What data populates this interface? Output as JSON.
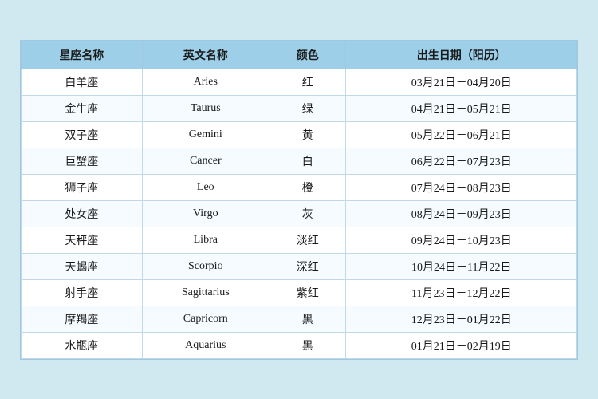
{
  "table": {
    "headers": [
      "星座名称",
      "英文名称",
      "颜色",
      "出生日期（阳历）"
    ],
    "rows": [
      {
        "chinese": "白羊座",
        "english": "Aries",
        "color": "红",
        "dates": "03月21日－04月20日"
      },
      {
        "chinese": "金牛座",
        "english": "Taurus",
        "color": "绿",
        "dates": "04月21日－05月21日"
      },
      {
        "chinese": "双子座",
        "english": "Gemini",
        "color": "黄",
        "dates": "05月22日－06月21日"
      },
      {
        "chinese": "巨蟹座",
        "english": "Cancer",
        "color": "白",
        "dates": "06月22日－07月23日"
      },
      {
        "chinese": "狮子座",
        "english": "Leo",
        "color": "橙",
        "dates": "07月24日－08月23日"
      },
      {
        "chinese": "处女座",
        "english": "Virgo",
        "color": "灰",
        "dates": "08月24日－09月23日"
      },
      {
        "chinese": "天秤座",
        "english": "Libra",
        "color": "淡红",
        "dates": "09月24日－10月23日"
      },
      {
        "chinese": "天蝎座",
        "english": "Scorpio",
        "color": "深红",
        "dates": "10月24日－11月22日"
      },
      {
        "chinese": "射手座",
        "english": "Sagittarius",
        "color": "紫红",
        "dates": "11月23日－12月22日"
      },
      {
        "chinese": "摩羯座",
        "english": "Capricorn",
        "color": "黑",
        "dates": "12月23日－01月22日"
      },
      {
        "chinese": "水瓶座",
        "english": "Aquarius",
        "color": "黑",
        "dates": "01月21日－02月19日"
      }
    ]
  }
}
